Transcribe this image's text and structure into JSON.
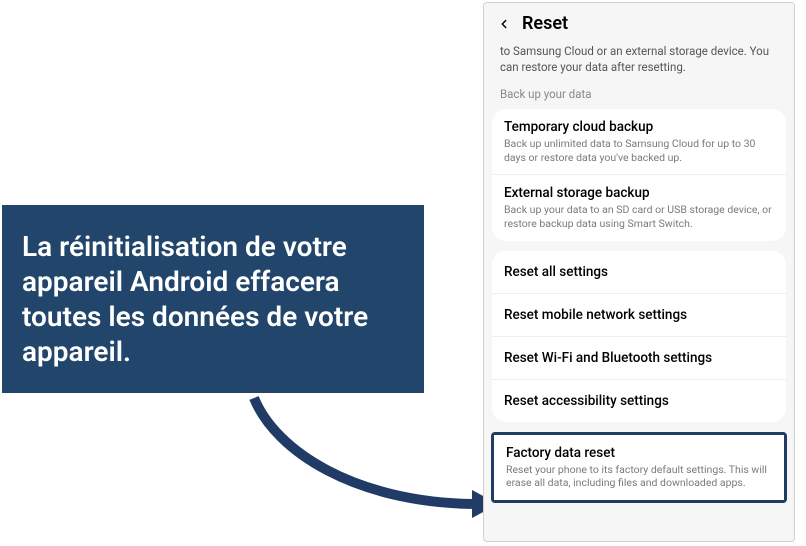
{
  "callout": {
    "text": "La réinitialisation de votre appareil Android effacera toutes les données de votre appareil."
  },
  "phone": {
    "title": "Reset",
    "intro": "to Samsung Cloud or an external storage device. You can restore your data after resetting.",
    "section_label": "Back up your data",
    "backup_card": {
      "rows": [
        {
          "title": "Temporary cloud backup",
          "sub": "Back up unlimited data to Samsung Cloud for up to 30 days or restore data you've backed up."
        },
        {
          "title": "External storage backup",
          "sub": "Back up your data to an SD card or USB storage device, or restore backup data using Smart Switch."
        }
      ]
    },
    "reset_card": {
      "rows": [
        {
          "title": "Reset all settings"
        },
        {
          "title": "Reset mobile network settings"
        },
        {
          "title": "Reset Wi-Fi and Bluetooth settings"
        },
        {
          "title": "Reset accessibility settings"
        }
      ]
    },
    "factory": {
      "title": "Factory data reset",
      "sub": "Reset your phone to its factory default settings. This will erase all data, including files and downloaded apps."
    }
  }
}
